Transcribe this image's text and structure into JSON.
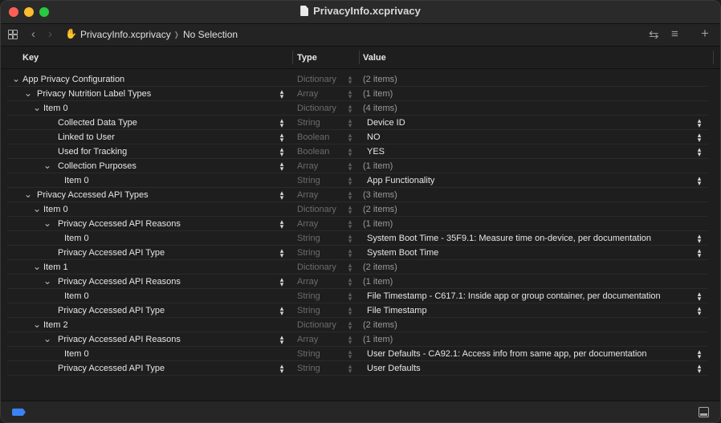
{
  "window": {
    "title": "PrivacyInfo.xcprivacy"
  },
  "jumpbar": {
    "file": "PrivacyInfo.xcprivacy",
    "separator": "❭",
    "selection": "No Selection"
  },
  "columns": {
    "key": "Key",
    "type": "Type",
    "value": "Value"
  },
  "rows": [
    {
      "key": "App Privacy Configuration",
      "type": "Dictionary",
      "value": "(2 items)",
      "level": 0,
      "disclosure": "open",
      "key_stepper": false,
      "value_stepper": false
    },
    {
      "key": "Privacy Nutrition Label Types",
      "type": "Array",
      "value": "(1 item)",
      "level": 1,
      "disclosure": "open",
      "key_stepper": true,
      "value_stepper": false
    },
    {
      "key": "Item 0",
      "type": "Dictionary",
      "value": "(4 items)",
      "level": 2,
      "disclosure": "open",
      "key_stepper": false,
      "value_stepper": false
    },
    {
      "key": "Collected Data Type",
      "type": "String",
      "value": "Device ID",
      "level": 3,
      "disclosure": "none",
      "key_stepper": true,
      "value_stepper": true
    },
    {
      "key": "Linked to User",
      "type": "Boolean",
      "value": "NO",
      "level": 3,
      "disclosure": "none",
      "key_stepper": true,
      "value_stepper": true
    },
    {
      "key": "Used for Tracking",
      "type": "Boolean",
      "value": "YES",
      "level": 3,
      "disclosure": "none",
      "key_stepper": true,
      "value_stepper": true
    },
    {
      "key": "Collection Purposes",
      "type": "Array",
      "value": "(1 item)",
      "level": 3,
      "disclosure": "open",
      "key_stepper": true,
      "value_stepper": false
    },
    {
      "key": "Item 0",
      "type": "String",
      "value": "App Functionality",
      "level": 4,
      "disclosure": "none",
      "key_stepper": false,
      "value_stepper": true
    },
    {
      "key": "Privacy Accessed API Types",
      "type": "Array",
      "value": "(3 items)",
      "level": 1,
      "disclosure": "open",
      "key_stepper": true,
      "value_stepper": false
    },
    {
      "key": "Item 0",
      "type": "Dictionary",
      "value": "(2 items)",
      "level": 2,
      "disclosure": "open",
      "key_stepper": false,
      "value_stepper": false
    },
    {
      "key": "Privacy Accessed API Reasons",
      "type": "Array",
      "value": "(1 item)",
      "level": 3,
      "disclosure": "open",
      "key_stepper": true,
      "value_stepper": false
    },
    {
      "key": "Item 0",
      "type": "String",
      "value": "System Boot Time - 35F9.1: Measure time on-device, per documentation",
      "level": 4,
      "disclosure": "none",
      "key_stepper": false,
      "value_stepper": true
    },
    {
      "key": "Privacy Accessed API Type",
      "type": "String",
      "value": "System Boot Time",
      "level": 3,
      "disclosure": "none",
      "key_stepper": true,
      "value_stepper": true
    },
    {
      "key": "Item 1",
      "type": "Dictionary",
      "value": "(2 items)",
      "level": 2,
      "disclosure": "open",
      "key_stepper": false,
      "value_stepper": false
    },
    {
      "key": "Privacy Accessed API Reasons",
      "type": "Array",
      "value": "(1 item)",
      "level": 3,
      "disclosure": "open",
      "key_stepper": true,
      "value_stepper": false
    },
    {
      "key": "Item 0",
      "type": "String",
      "value": "File Timestamp - C617.1: Inside app or group container, per documentation",
      "level": 4,
      "disclosure": "none",
      "key_stepper": false,
      "value_stepper": true
    },
    {
      "key": "Privacy Accessed API Type",
      "type": "String",
      "value": "File Timestamp",
      "level": 3,
      "disclosure": "none",
      "key_stepper": true,
      "value_stepper": true
    },
    {
      "key": "Item 2",
      "type": "Dictionary",
      "value": "(2 items)",
      "level": 2,
      "disclosure": "open",
      "key_stepper": false,
      "value_stepper": false
    },
    {
      "key": "Privacy Accessed API Reasons",
      "type": "Array",
      "value": "(1 item)",
      "level": 3,
      "disclosure": "open",
      "key_stepper": true,
      "value_stepper": false
    },
    {
      "key": "Item 0",
      "type": "String",
      "value": "User Defaults - CA92.1: Access info from same app, per documentation",
      "level": 4,
      "disclosure": "none",
      "key_stepper": false,
      "value_stepper": true
    },
    {
      "key": "Privacy Accessed API Type",
      "type": "String",
      "value": "User Defaults",
      "level": 3,
      "disclosure": "none",
      "key_stepper": true,
      "value_stepper": true
    }
  ],
  "icons": {
    "grid": "grid-icon",
    "back": "chevron-left-icon",
    "forward": "chevron-right-icon",
    "file": "hand-icon",
    "sync": "arrows-icon",
    "lines": "list-icon",
    "add": "plus-icon",
    "nav": "sidebar-icon",
    "panel": "panel-icon"
  }
}
